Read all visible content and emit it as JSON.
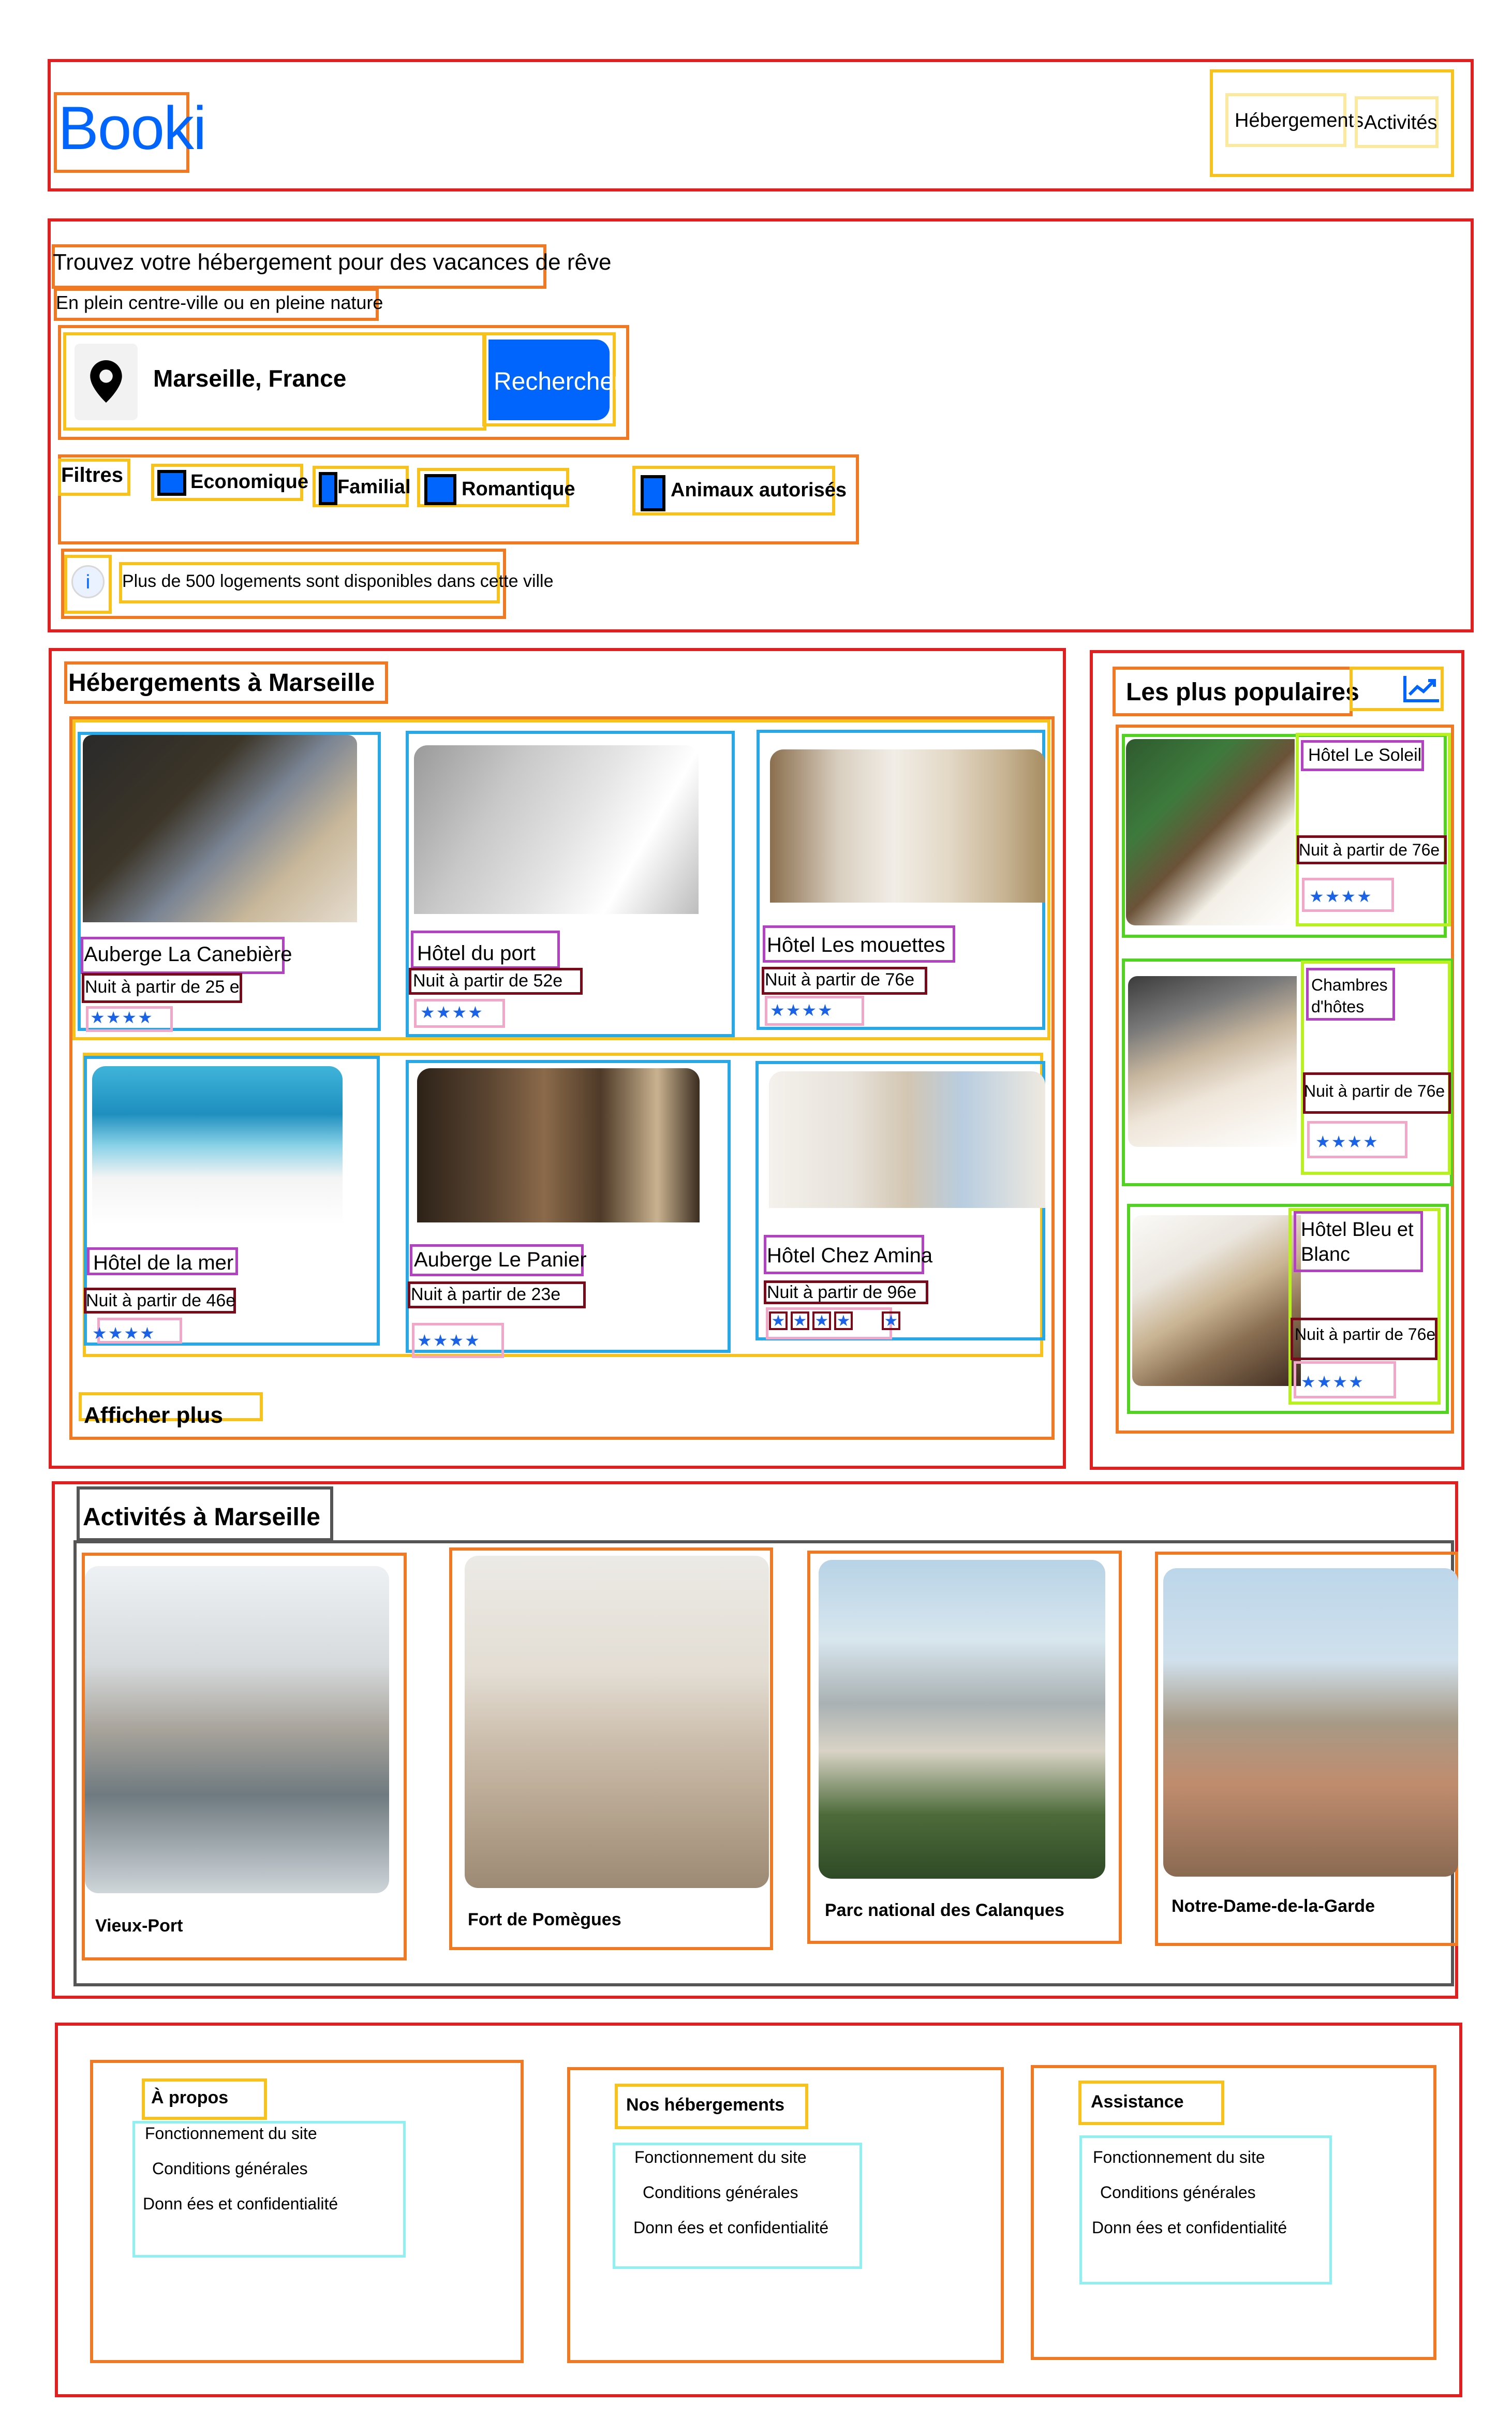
{
  "header": {
    "logo": "Booki",
    "nav": [
      "Hébergements",
      "Activités"
    ]
  },
  "search": {
    "title": "Trouvez votre hébergement pour des vacances de rêve",
    "subtitle": "En plein centre-ville ou en pleine nature",
    "location_value": "Marseille, France",
    "button_label": "Rechercher",
    "filters_label": "Filtres",
    "filters": [
      "Economique",
      "Familial",
      "Romantique",
      "Animaux autorisés"
    ],
    "info_text": "Plus de 500 logements sont disponibles dans cette ville"
  },
  "lodgings": {
    "title": "Hébergements à Marseille",
    "cards": [
      {
        "name": "Auberge La Canebière",
        "price": "Nuit à partir de 25 e"
      },
      {
        "name": "Hôtel du port",
        "price": "Nuit à partir de 52e"
      },
      {
        "name": "Hôtel Les mouettes",
        "price": "Nuit à partir de 76e"
      },
      {
        "name": "Hôtel de la mer",
        "price": "Nuit à partir de 46e"
      },
      {
        "name": "Auberge Le Panier",
        "price": "Nuit à partir de 23e"
      },
      {
        "name": "Hôtel Chez Amina",
        "price": "Nuit à partir de 96e"
      }
    ],
    "show_more": "Afficher plus"
  },
  "popular": {
    "title": "Les plus populaires",
    "icon": "trending-up-icon",
    "cards": [
      {
        "name": "Hôtel Le Soleil",
        "price": "Nuit à partir de 76e"
      },
      {
        "name": "Chambres d'hôtes",
        "price": "Nuit à partir de 76e"
      },
      {
        "name": "Hôtel Bleu et Blanc",
        "price": "Nuit à partir de 76e"
      }
    ]
  },
  "activities": {
    "title": "Activités à Marseille",
    "items": [
      "Vieux-Port",
      "Fort de Pomègues",
      "Parc national des Calanques",
      "Notre-Dame-de-la-Garde"
    ]
  },
  "footer": {
    "columns": [
      {
        "title": "À propos",
        "links": [
          "Fonctionnement du site",
          "Conditions générales",
          "Donn ées et confidentialité"
        ]
      },
      {
        "title": "Nos hébergements",
        "links": [
          "Fonctionnement du site",
          "Conditions générales",
          "Donn ées et confidentialité"
        ]
      },
      {
        "title": "Assistance",
        "links": [
          "Fonctionnement du site",
          "Conditions générales",
          "Donn ées et confidentialité"
        ]
      }
    ]
  },
  "colors": {
    "brand_blue": "#0065fc",
    "star_blue": "#1a63e8",
    "annotation_red": "#e02020",
    "annotation_orange": "#f07a24",
    "annotation_yellow": "#f8c21c"
  }
}
